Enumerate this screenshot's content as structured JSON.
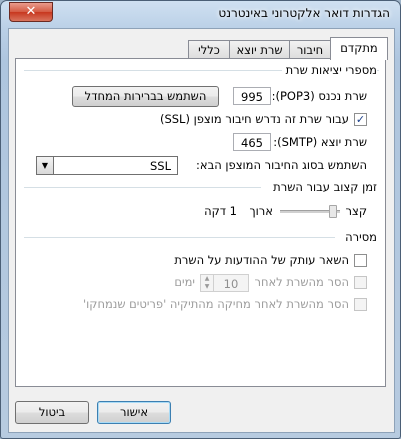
{
  "window": {
    "title": "הגדרות דואר אלקטרוני באינטרנט",
    "close_label": "✕"
  },
  "tabs": [
    {
      "label": "מתקדם",
      "active": true
    },
    {
      "label": "חיבור",
      "active": false
    },
    {
      "label": "שרת יוצא",
      "active": false
    },
    {
      "label": "כללי",
      "active": false
    }
  ],
  "server_ports": {
    "group_title": "מספרי יציאות שרת",
    "incoming_label": "שרת נכנס (POP3):",
    "incoming_value": "995",
    "use_defaults_button": "השתמש בברירות המחדל",
    "ssl_checkbox_label": "עבור שרת זה נדרש חיבור מוצפן (SSL)",
    "ssl_checked": true,
    "outgoing_label": "שרת יוצא (SMTP):",
    "outgoing_value": "465",
    "encryption_label": "השתמש בסוג החיבור המוצפן הבא:",
    "encryption_value": "SSL"
  },
  "timeouts": {
    "group_title": "זמן קצוב עבור השרת",
    "short_label": "קצר",
    "long_label": "ארוך",
    "value_label": "1 דקה",
    "level": 0.05
  },
  "delivery": {
    "group_title": "מסירה",
    "leave_copy_label": "השאר עותק של ההודעות על השרת",
    "leave_copy_checked": false,
    "remove_after_label": "הסר מהשרת לאחר",
    "remove_after_value": "10",
    "days_label": "ימים",
    "remove_when_deleted_label": "הסר מהשרת לאחר מחיקה מהתיקיה 'פריטים שנמחקו'"
  },
  "buttons": {
    "ok": "אישור",
    "cancel": "ביטול"
  }
}
